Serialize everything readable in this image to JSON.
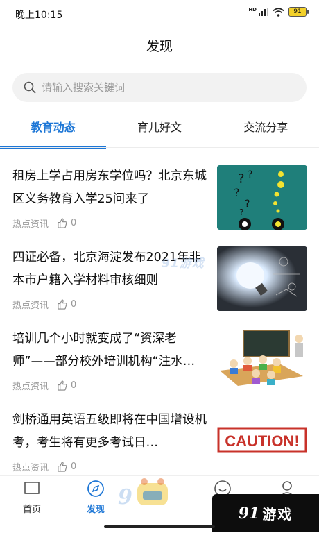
{
  "status_bar": {
    "time": "晚上10:15",
    "network": "HD",
    "battery": "91"
  },
  "page": {
    "title": "发现"
  },
  "search": {
    "placeholder": "请输入搜索关键词"
  },
  "tabs": [
    {
      "label": "教育动态",
      "active": true
    },
    {
      "label": "育儿好文",
      "active": false
    },
    {
      "label": "交流分享",
      "active": false
    }
  ],
  "articles": [
    {
      "title": "租房上学占用房东学位吗？北京东城区义务教育入学25问来了",
      "category": "热点资讯",
      "likes": "0",
      "thumb": "question-bulbs"
    },
    {
      "title": "四证必备，北京海淀发布2021年非本市户籍入学材料审核细则",
      "category": "热点资讯",
      "likes": "0",
      "thumb": "lightbulb-strategy"
    },
    {
      "title": "培训几个小时就变成了“资深老师”——部分校外培训机构“注水…",
      "category": "热点资讯",
      "likes": "0",
      "thumb": "classroom-cartoon"
    },
    {
      "title": "剑桥通用英语五级即将在中国增设机考，考生将有更多考试日…",
      "category": "热点资讯",
      "likes": "0",
      "thumb": "caution-sign",
      "caution_text": "CAUTION!"
    }
  ],
  "bottom_nav": [
    {
      "label": "首页",
      "icon": "home-icon",
      "active": false
    },
    {
      "label": "发现",
      "icon": "compass-icon",
      "active": true
    },
    {
      "label": "",
      "icon": "smile-icon",
      "active": false
    },
    {
      "label": "",
      "icon": "user-icon",
      "active": false
    }
  ],
  "watermark": {
    "brand_number": "91",
    "brand_text": "游戏",
    "brand_mid": "91游戏"
  },
  "colors": {
    "accent": "#1e77d6",
    "battery": "#f3d12a",
    "thumb_teal": "#1f7f7a",
    "caution_red": "#c8322a"
  }
}
